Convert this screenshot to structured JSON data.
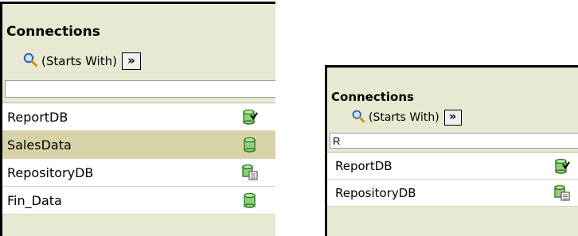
{
  "left_panel": {
    "title": "Connections",
    "filter_label": "(Starts With)",
    "more_button": "»",
    "search_value": "",
    "items": [
      {
        "label": "ReportDB",
        "icon": "database-check-icon",
        "selected": false
      },
      {
        "label": "SalesData",
        "icon": "database-icon",
        "selected": true
      },
      {
        "label": "RepositoryDB",
        "icon": "database-document-icon",
        "selected": false
      },
      {
        "label": "Fin_Data",
        "icon": "database-icon",
        "selected": false
      }
    ]
  },
  "right_panel": {
    "title": "Connections",
    "filter_label": "(Starts With)",
    "more_button": "»",
    "search_value": "R",
    "items": [
      {
        "label": "ReportDB",
        "icon": "database-check-icon",
        "selected": false
      },
      {
        "label": "RepositoryDB",
        "icon": "database-document-icon",
        "selected": false
      }
    ]
  },
  "colors": {
    "panel_bg": "#e9e9d3",
    "selected_row": "#d8d2a8",
    "db_green": "#8fd17a",
    "db_stroke": "#2f7a2a"
  }
}
